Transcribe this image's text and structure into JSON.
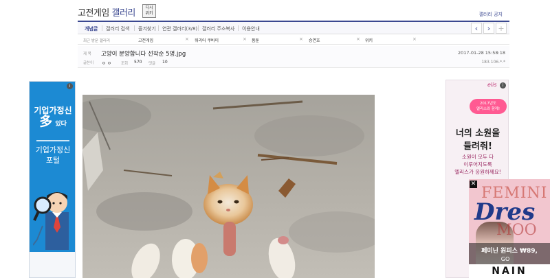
{
  "header": {
    "title_dark": "고전게임",
    "title_blue": "갤러리",
    "wiki_badge_line1": "디시",
    "wiki_badge_line2": "위키",
    "notice_link": "갤러리 공지"
  },
  "nav": {
    "items": [
      "개념글",
      "갤러리 검색",
      "즐겨찾기",
      "연관 갤러리(3/8)",
      "갤러리 주소복사",
      "이용안내"
    ],
    "prev_icon": "chevron-left-icon",
    "next_icon": "chevron-right-icon",
    "add_icon": "plus-icon"
  },
  "recent": {
    "label": "최근 방문 갤러리",
    "items": [
      "고전게임",
      "워리어 쿠바이",
      "품툰",
      "승연호",
      "위키"
    ]
  },
  "post": {
    "subject_label": "제 목",
    "title": "고양이 분양합니다 선착순 5명.jpg",
    "date": "2017-01-28 15:58:18",
    "writer_label": "글쓴이",
    "writer": "ㅇㅇ",
    "views_label": "조회",
    "views": "570",
    "comments_label": "댓글",
    "comments": "10",
    "ip": "183.106.*.*"
  },
  "left_ad": {
    "info_icon": "info-icon",
    "headline_line1": "기업가정신",
    "headline_big": "多",
    "headline_small": "있다",
    "sub_line1": "기업가정신",
    "sub_line2": "포털"
  },
  "right_ad": {
    "info_icon": "info-icon",
    "logo": "elis",
    "banner_line1": "2017년도",
    "banner_line2": "엘리스와 함께!",
    "main_line1": "너의 소원을",
    "main_line2": "들려줘!",
    "sub_line1": "소원이 모두 다",
    "sub_line2": "이루어지도록",
    "sub_line3": "엘리스가 응원하께요!"
  },
  "overlay_ad": {
    "close_icon": "close-icon",
    "bg_word": "FEMINI",
    "bg_word2": "MOO",
    "script_word": "Dres",
    "caption": "페미닌 원피스 ₩89,",
    "go": "GO",
    "brand": "NAIN"
  },
  "colors": {
    "accent": "#3b4890",
    "left_ad_blue": "#1c8ad3",
    "right_ad_pink": "#ff5a92"
  }
}
